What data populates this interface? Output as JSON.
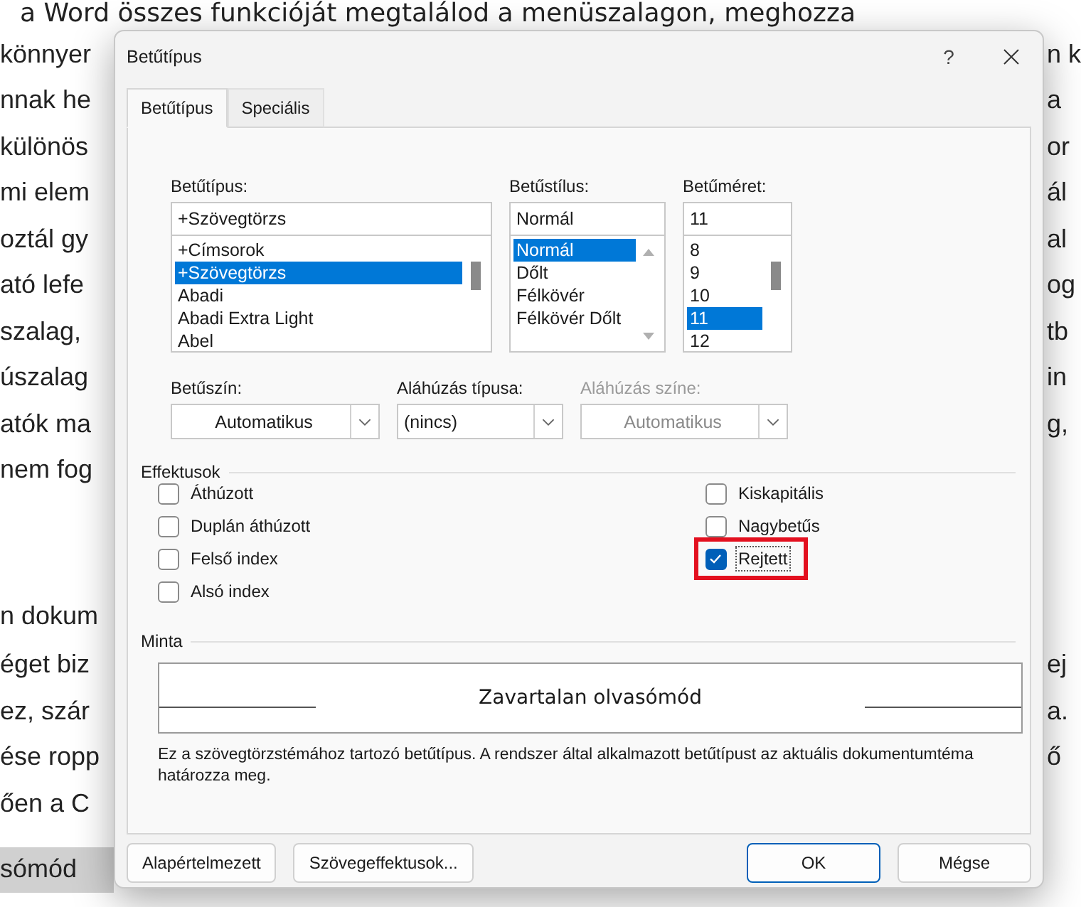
{
  "document": {
    "top_line": "a Word összes funkcióját megtalálod a menüszalagon, meghozza",
    "paragraphs": [
      {
        "kind": "body",
        "lines": [
          {
            "left": "könnyer",
            "right": "n k"
          },
          {
            "left": "nnak he",
            "right": "a"
          },
          {
            "left": "különös",
            "right": "or"
          },
          {
            "left": "mi elem",
            "right": "ál"
          },
          {
            "left": "oztál gy",
            "right": "al"
          },
          {
            "left": "ató lefe",
            "right": "og"
          },
          {
            "left": "szalag,",
            "right": "tb"
          },
          {
            "left": "úszalag",
            "right": "in"
          },
          {
            "left": "atók ma",
            "right": "g,"
          },
          {
            "left": "nem fog"
          }
        ]
      },
      {
        "kind": "heading",
        "lines": [
          {
            "left": "n dokum"
          }
        ]
      },
      {
        "kind": "body",
        "lines": [
          {
            "left": "éget biz",
            "right": "ej"
          },
          {
            "left": "ez, szár",
            "right": "a."
          },
          {
            "left": "ése ropp",
            "right": "ő"
          },
          {
            "left": "ően a C"
          }
        ]
      },
      {
        "kind": "highlight",
        "lines": [
          {
            "left": "sómód"
          }
        ]
      }
    ]
  },
  "dialog": {
    "title": "Betűtípus",
    "help": "?",
    "tabs": [
      {
        "label": "Betűtípus",
        "selected": true
      },
      {
        "label": "Speciális",
        "selected": false
      }
    ],
    "font": {
      "label": "Betűtípus:",
      "value": "+Szövegtörzs",
      "items": [
        {
          "label": "+Címsorok",
          "selected": false
        },
        {
          "label": "+Szövegtörzs",
          "selected": true
        },
        {
          "label": "Abadi",
          "selected": false
        },
        {
          "label": "Abadi Extra Light",
          "selected": false
        },
        {
          "label": "Abel",
          "selected": false
        }
      ]
    },
    "style": {
      "label": "Betűstílus:",
      "value": "Normál",
      "items": [
        {
          "label": "Normál",
          "selected": true
        },
        {
          "label": "Dőlt",
          "selected": false
        },
        {
          "label": "Félkövér",
          "selected": false
        },
        {
          "label": "Félkövér Dőlt",
          "selected": false
        }
      ]
    },
    "size": {
      "label": "Betűméret:",
      "value": "11",
      "items": [
        {
          "label": "8",
          "selected": false
        },
        {
          "label": "9",
          "selected": false
        },
        {
          "label": "10",
          "selected": false
        },
        {
          "label": "11",
          "selected": true
        },
        {
          "label": "12",
          "selected": false
        }
      ]
    },
    "dropdowns": [
      {
        "label": "Betűszín:",
        "value": "Automatikus",
        "disabled": false
      },
      {
        "label": "Aláhúzás típusa:",
        "value": "(nincs)",
        "disabled": false
      },
      {
        "label": "Aláhúzás színe:",
        "value": "Automatikus",
        "disabled": true
      }
    ],
    "effects": {
      "title": "Effektusok",
      "left": [
        {
          "label": "Áthúzott",
          "checked": false
        },
        {
          "label": "Duplán áthúzott",
          "checked": false
        },
        {
          "label": "Felső index",
          "checked": false
        },
        {
          "label": "Alsó index",
          "checked": false
        }
      ],
      "right": [
        {
          "label": "Kiskapitális",
          "checked": false
        },
        {
          "label": "Nagybetűs",
          "checked": false
        },
        {
          "label": "Rejtett",
          "checked": true,
          "highlighted": true
        }
      ]
    },
    "preview": {
      "title": "Minta",
      "sample": "Zavartalan olvasómód",
      "description": "Ez a szövegtörzstémához tartozó betűtípus. A rendszer által alkalmazott betűtípust az aktuális dokumentumtéma határozza meg."
    },
    "buttons": [
      {
        "label": "Alapértelmezett",
        "kind": "secondary"
      },
      {
        "label": "Szövegeffektusok...",
        "kind": "secondary"
      },
      {
        "label": "OK",
        "kind": "default"
      },
      {
        "label": "Mégse",
        "kind": "normal"
      }
    ]
  }
}
